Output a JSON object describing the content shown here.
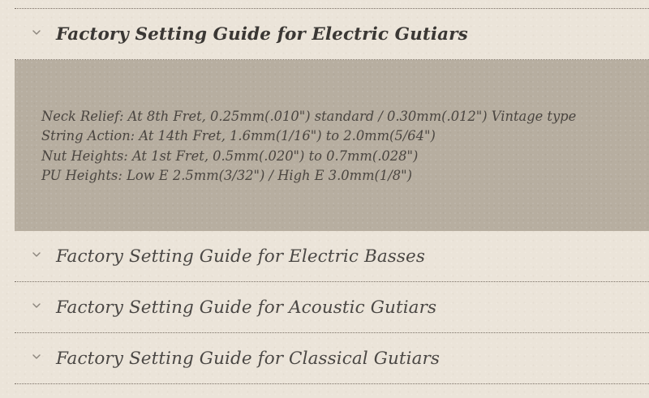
{
  "accordion": {
    "items": [
      {
        "title": "Factory Setting Guide for Electric Gutiars",
        "expanded": true,
        "content": [
          "Neck Relief: At 8th Fret, 0.25mm(.010\") standard / 0.30mm(.012\") Vintage type",
          "String Action: At 14th Fret, 1.6mm(1/16\") to 2.0mm(5/64\")",
          "Nut Heights: At 1st Fret, 0.5mm(.020\") to 0.7mm(.028\")",
          "PU Heights: Low E 2.5mm(3/32\") / High E 3.0mm(1/8\")"
        ]
      },
      {
        "title": "Factory Setting Guide for Electric Basses",
        "expanded": false
      },
      {
        "title": "Factory Setting Guide for Acoustic Gutiars",
        "expanded": false
      },
      {
        "title": "Factory Setting Guide for Classical Gutiars",
        "expanded": false
      }
    ]
  },
  "icons": {
    "toggle": "chevron-down-icon"
  },
  "colors": {
    "page_background": "#ebe4d9",
    "panel_background": "#b7aea0",
    "text": "#4a4744",
    "divider": "#7a7066"
  }
}
